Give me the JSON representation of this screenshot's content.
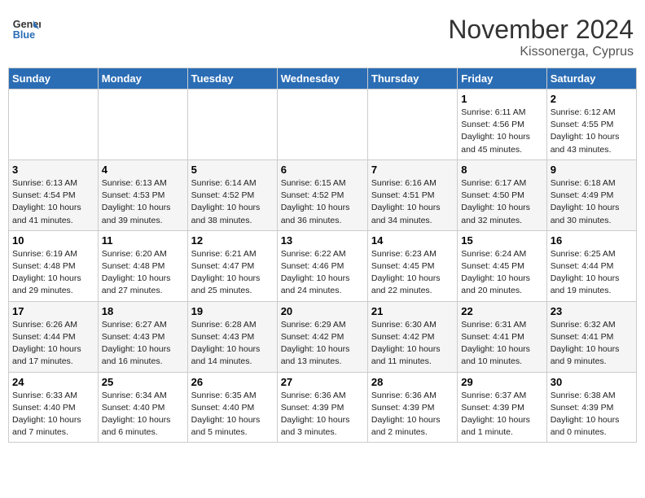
{
  "logo": {
    "general": "General",
    "blue": "Blue"
  },
  "title": "November 2024",
  "subtitle": "Kissonerga, Cyprus",
  "days_of_week": [
    "Sunday",
    "Monday",
    "Tuesday",
    "Wednesday",
    "Thursday",
    "Friday",
    "Saturday"
  ],
  "weeks": [
    [
      {
        "day": "",
        "info": ""
      },
      {
        "day": "",
        "info": ""
      },
      {
        "day": "",
        "info": ""
      },
      {
        "day": "",
        "info": ""
      },
      {
        "day": "",
        "info": ""
      },
      {
        "day": "1",
        "info": "Sunrise: 6:11 AM\nSunset: 4:56 PM\nDaylight: 10 hours\nand 45 minutes."
      },
      {
        "day": "2",
        "info": "Sunrise: 6:12 AM\nSunset: 4:55 PM\nDaylight: 10 hours\nand 43 minutes."
      }
    ],
    [
      {
        "day": "3",
        "info": "Sunrise: 6:13 AM\nSunset: 4:54 PM\nDaylight: 10 hours\nand 41 minutes."
      },
      {
        "day": "4",
        "info": "Sunrise: 6:13 AM\nSunset: 4:53 PM\nDaylight: 10 hours\nand 39 minutes."
      },
      {
        "day": "5",
        "info": "Sunrise: 6:14 AM\nSunset: 4:52 PM\nDaylight: 10 hours\nand 38 minutes."
      },
      {
        "day": "6",
        "info": "Sunrise: 6:15 AM\nSunset: 4:52 PM\nDaylight: 10 hours\nand 36 minutes."
      },
      {
        "day": "7",
        "info": "Sunrise: 6:16 AM\nSunset: 4:51 PM\nDaylight: 10 hours\nand 34 minutes."
      },
      {
        "day": "8",
        "info": "Sunrise: 6:17 AM\nSunset: 4:50 PM\nDaylight: 10 hours\nand 32 minutes."
      },
      {
        "day": "9",
        "info": "Sunrise: 6:18 AM\nSunset: 4:49 PM\nDaylight: 10 hours\nand 30 minutes."
      }
    ],
    [
      {
        "day": "10",
        "info": "Sunrise: 6:19 AM\nSunset: 4:48 PM\nDaylight: 10 hours\nand 29 minutes."
      },
      {
        "day": "11",
        "info": "Sunrise: 6:20 AM\nSunset: 4:48 PM\nDaylight: 10 hours\nand 27 minutes."
      },
      {
        "day": "12",
        "info": "Sunrise: 6:21 AM\nSunset: 4:47 PM\nDaylight: 10 hours\nand 25 minutes."
      },
      {
        "day": "13",
        "info": "Sunrise: 6:22 AM\nSunset: 4:46 PM\nDaylight: 10 hours\nand 24 minutes."
      },
      {
        "day": "14",
        "info": "Sunrise: 6:23 AM\nSunset: 4:45 PM\nDaylight: 10 hours\nand 22 minutes."
      },
      {
        "day": "15",
        "info": "Sunrise: 6:24 AM\nSunset: 4:45 PM\nDaylight: 10 hours\nand 20 minutes."
      },
      {
        "day": "16",
        "info": "Sunrise: 6:25 AM\nSunset: 4:44 PM\nDaylight: 10 hours\nand 19 minutes."
      }
    ],
    [
      {
        "day": "17",
        "info": "Sunrise: 6:26 AM\nSunset: 4:44 PM\nDaylight: 10 hours\nand 17 minutes."
      },
      {
        "day": "18",
        "info": "Sunrise: 6:27 AM\nSunset: 4:43 PM\nDaylight: 10 hours\nand 16 minutes."
      },
      {
        "day": "19",
        "info": "Sunrise: 6:28 AM\nSunset: 4:43 PM\nDaylight: 10 hours\nand 14 minutes."
      },
      {
        "day": "20",
        "info": "Sunrise: 6:29 AM\nSunset: 4:42 PM\nDaylight: 10 hours\nand 13 minutes."
      },
      {
        "day": "21",
        "info": "Sunrise: 6:30 AM\nSunset: 4:42 PM\nDaylight: 10 hours\nand 11 minutes."
      },
      {
        "day": "22",
        "info": "Sunrise: 6:31 AM\nSunset: 4:41 PM\nDaylight: 10 hours\nand 10 minutes."
      },
      {
        "day": "23",
        "info": "Sunrise: 6:32 AM\nSunset: 4:41 PM\nDaylight: 10 hours\nand 9 minutes."
      }
    ],
    [
      {
        "day": "24",
        "info": "Sunrise: 6:33 AM\nSunset: 4:40 PM\nDaylight: 10 hours\nand 7 minutes."
      },
      {
        "day": "25",
        "info": "Sunrise: 6:34 AM\nSunset: 4:40 PM\nDaylight: 10 hours\nand 6 minutes."
      },
      {
        "day": "26",
        "info": "Sunrise: 6:35 AM\nSunset: 4:40 PM\nDaylight: 10 hours\nand 5 minutes."
      },
      {
        "day": "27",
        "info": "Sunrise: 6:36 AM\nSunset: 4:39 PM\nDaylight: 10 hours\nand 3 minutes."
      },
      {
        "day": "28",
        "info": "Sunrise: 6:36 AM\nSunset: 4:39 PM\nDaylight: 10 hours\nand 2 minutes."
      },
      {
        "day": "29",
        "info": "Sunrise: 6:37 AM\nSunset: 4:39 PM\nDaylight: 10 hours\nand 1 minute."
      },
      {
        "day": "30",
        "info": "Sunrise: 6:38 AM\nSunset: 4:39 PM\nDaylight: 10 hours\nand 0 minutes."
      }
    ]
  ]
}
